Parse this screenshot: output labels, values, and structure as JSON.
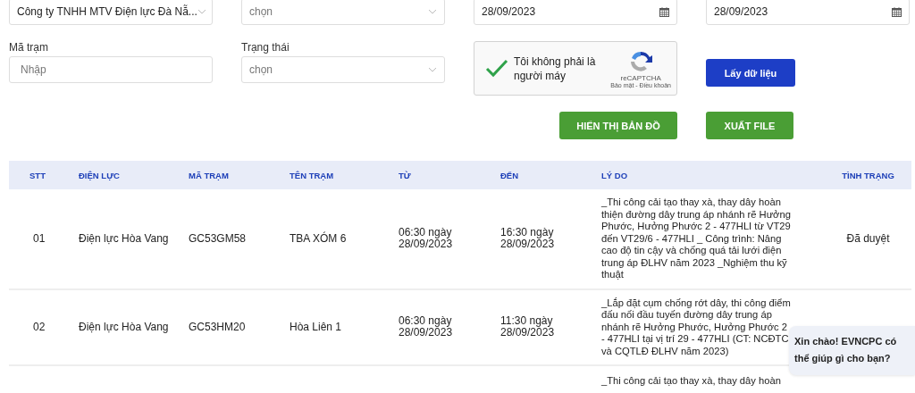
{
  "filters_top": [
    {
      "kind": "select",
      "value": "Công ty TNHH MTV Điện lực Đà Nẵ..."
    },
    {
      "kind": "select",
      "placeholder": "chọn"
    },
    {
      "kind": "date",
      "value": "28/09/2023"
    },
    {
      "kind": "date",
      "value": "28/09/2023"
    }
  ],
  "filters": [
    {
      "kind": "text",
      "label": "Mã trạm",
      "placeholder": "Nhập"
    },
    {
      "kind": "select",
      "label": "Trạng thái",
      "placeholder": "chọn"
    }
  ],
  "captcha": {
    "label": "Tôi không phải là người máy",
    "brand": "reCAPTCHA",
    "links": "Bảo mật - Điều khoản",
    "checked": true
  },
  "fetch_button": "Lấy dữ liệu",
  "action_buttons": [
    "HIỂN THỊ BẢN ĐỒ",
    "XUẤT FILE"
  ],
  "table": {
    "columns": [
      "STT",
      "ĐIỆN LỰC",
      "MÃ TRẠM",
      "TÊN TRẠM",
      "TỪ",
      "ĐẾN",
      "LÝ DO",
      "TÌNH TRẠNG"
    ],
    "rows": [
      {
        "stt": "01",
        "unit": "Điện lực Hòa Vang",
        "code": "GC53GM58",
        "name": "TBA XÓM 6",
        "from": "06:30 ngày 28/09/2023",
        "to": "16:30 ngày 28/09/2023",
        "reason": "_Thi công cải tạo thay xà, thay dây hoàn thiện đường dây trung áp nhánh rẽ Hưởng Phước, Hưởng Phước 2 - 477HLI từ VT29 đến VT29/6 - 477HLI _ Công trình: Nâng cao độ tin cậy và chống quá tải lưới điện trung áp ĐLHV năm 2023 _Nghiệm thu kỹ thuật",
        "status": "Đã duyệt"
      },
      {
        "stt": "02",
        "unit": "Điện lực Hòa Vang",
        "code": "GC53HM20",
        "name": "Hòa Liên 1",
        "from": "06:30 ngày 28/09/2023",
        "to": "11:30 ngày 28/09/2023",
        "reason": "_Lắp đặt cụm chống rớt dây, thi công điểm đấu nối đầu tuyến đường dây trung áp nhánh rẽ Hưởng Phước, Hưởng Phước 2 - 477HLI tại vị trí 29 - 477HLI (CT: NCĐTC và CQTLĐ ĐLHV năm 2023)"
      },
      {
        "reason": "_Thi công cải tạo thay xà, thay dây hoàn"
      }
    ]
  },
  "chat_bubble": "Xin chào! EVNCPC có thể giúp gì cho bạn?"
}
